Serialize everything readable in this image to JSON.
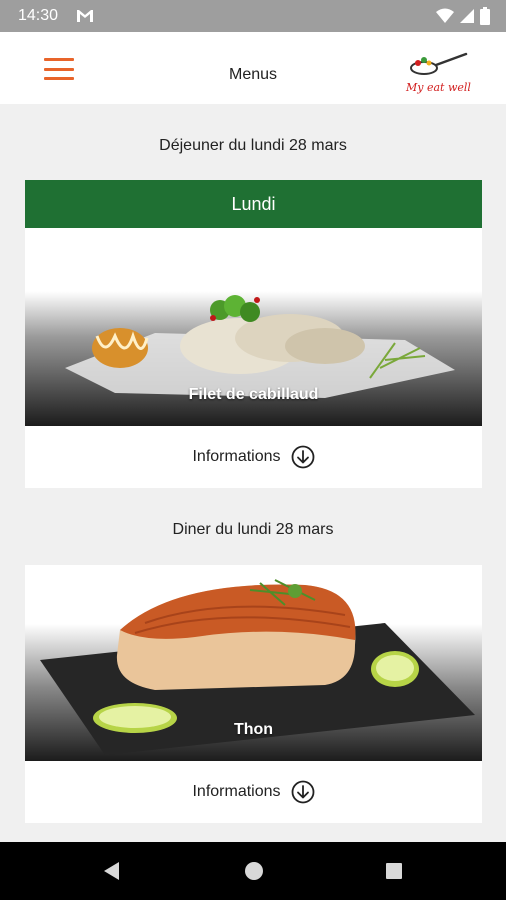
{
  "status_bar": {
    "time": "14:30"
  },
  "app_bar": {
    "title": "Menus",
    "logo_text": "My eat well",
    "accent_color": "#e8642a"
  },
  "lunch": {
    "heading": "Déjeuner du lundi 28 mars",
    "day_label": "Lundi",
    "dish": "Filet de cabillaud",
    "info_label": "Informations"
  },
  "dinner": {
    "heading": "Diner du lundi 28 mars",
    "dish": "Thon",
    "info_label": "Informations"
  },
  "colors": {
    "day_header": "#1f7033",
    "background": "#f0f0f0"
  }
}
